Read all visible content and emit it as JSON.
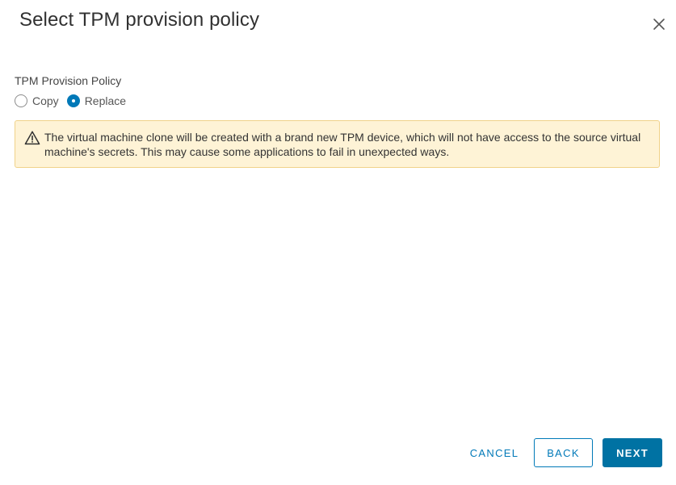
{
  "dialog": {
    "title": "Select TPM provision policy",
    "close_icon": "close-icon"
  },
  "policy": {
    "label": "TPM Provision Policy",
    "options": [
      {
        "label": "Copy",
        "selected": false
      },
      {
        "label": "Replace",
        "selected": true
      }
    ]
  },
  "alert": {
    "icon": "warning-icon",
    "message": "The virtual machine clone will be created with a brand new TPM device, which will not have access to the source virtual machine's secrets. This may cause some applications to fail in unexpected ways."
  },
  "footer": {
    "cancel_label": "CANCEL",
    "back_label": "BACK",
    "next_label": "NEXT"
  },
  "colors": {
    "accent": "#0079b8",
    "primary_button": "#0072a3",
    "warning_bg": "#fef3d6",
    "warning_border": "#f0d28a"
  }
}
